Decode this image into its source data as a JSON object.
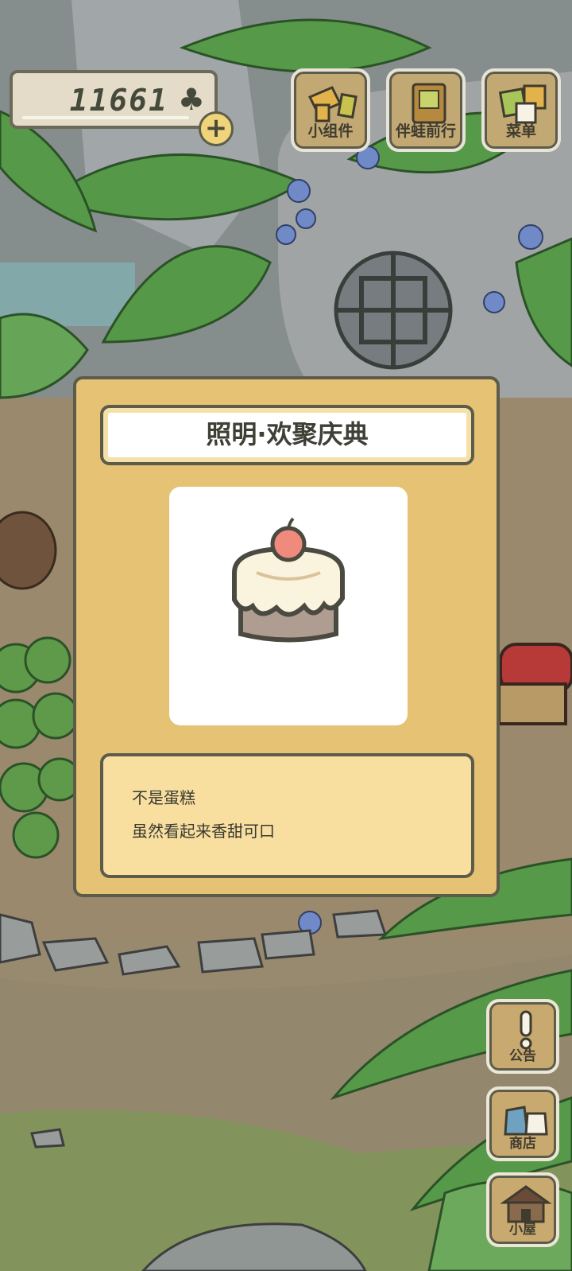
{
  "hud": {
    "clover_count": "11661",
    "clover_symbol": "♣",
    "add_symbol": "+"
  },
  "top_menu": [
    {
      "label": "小组件",
      "icon": "widget-icon"
    },
    {
      "label": "伴蛙前行",
      "icon": "companion-book-icon"
    },
    {
      "label": "菜单",
      "icon": "menu-cards-icon"
    }
  ],
  "side_menu": [
    {
      "label": "公告",
      "icon": "exclamation-icon"
    },
    {
      "label": "商店",
      "icon": "shop-bags-icon"
    },
    {
      "label": "小屋",
      "icon": "house-icon"
    }
  ],
  "item_popup": {
    "title": "照明·欢聚庆典",
    "item_icon": "cake-lamp-icon",
    "description_lines": [
      "不是蛋糕",
      "虽然看起来香甜可口"
    ]
  },
  "colors": {
    "popup_bg": "#e6c274",
    "desc_bg": "#f8dfa0",
    "button_wood": "#c2a872",
    "outline": "#5d5c4b"
  }
}
